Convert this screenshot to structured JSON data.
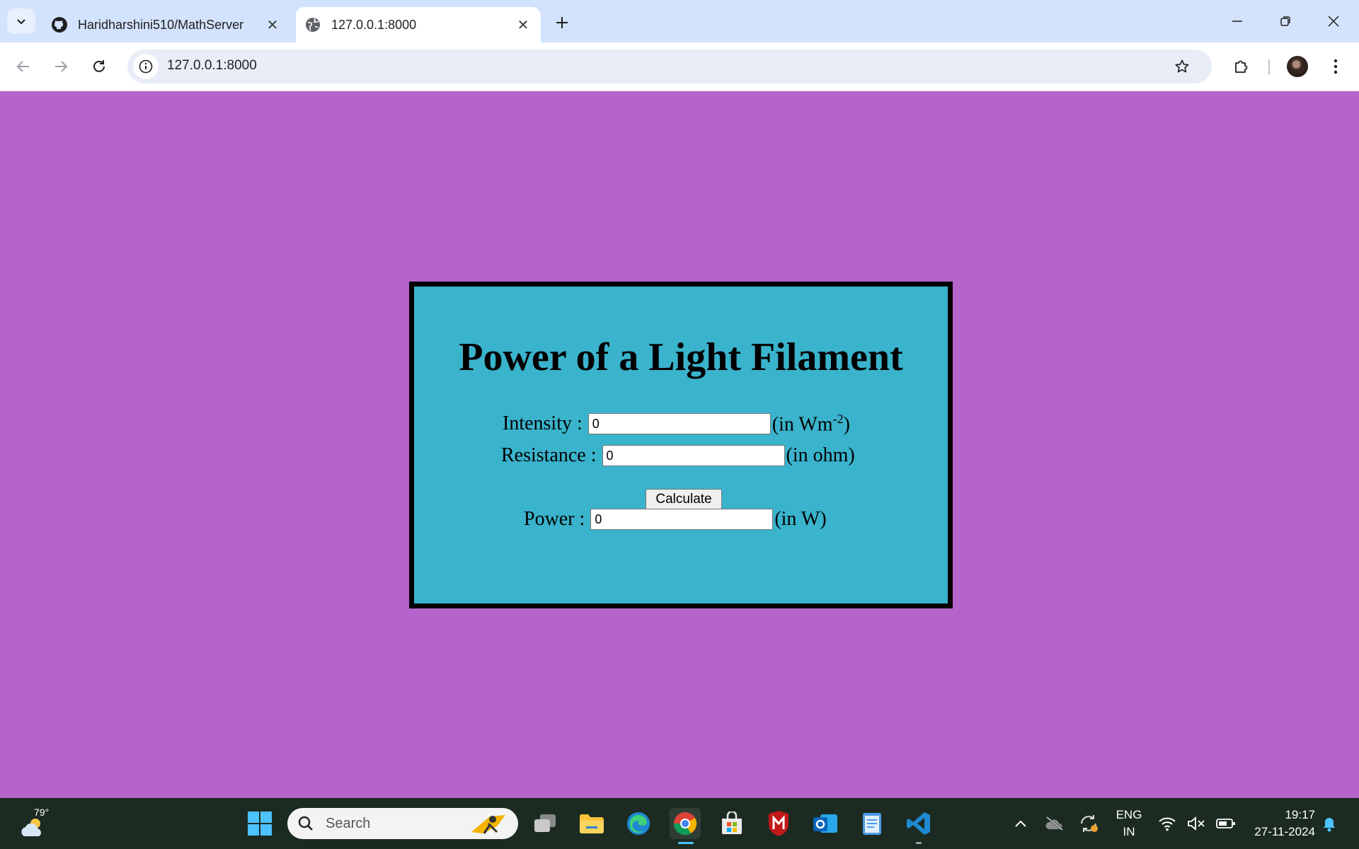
{
  "browser": {
    "tabs": [
      {
        "label": "Haridharshini510/MathServer",
        "icon": "github-icon",
        "active": false
      },
      {
        "label": "127.0.0.1:8000",
        "icon": "globe-icon",
        "active": true
      }
    ],
    "new_tab": "+",
    "url": "127.0.0.1:8000"
  },
  "page": {
    "title": "Power of a Light Filament",
    "intensity": {
      "label": "Intensity :",
      "value": "0",
      "unit_prefix": "(in Wm",
      "unit_sup": "-2",
      "unit_suffix": ")"
    },
    "resistance": {
      "label": "Resistance :",
      "value": "0",
      "unit": "(in ohm)"
    },
    "calculate_label": "Calculate",
    "power": {
      "label": "Power :",
      "value": "0",
      "unit": "(in W)"
    },
    "colors": {
      "background": "#b564cc",
      "card": "#3ab3cc",
      "border": "#000000"
    }
  },
  "taskbar": {
    "weather": "79°",
    "search_placeholder": "Search",
    "language_line1": "ENG",
    "language_line2": "IN",
    "time": "19:17",
    "date": "27-11-2024"
  }
}
